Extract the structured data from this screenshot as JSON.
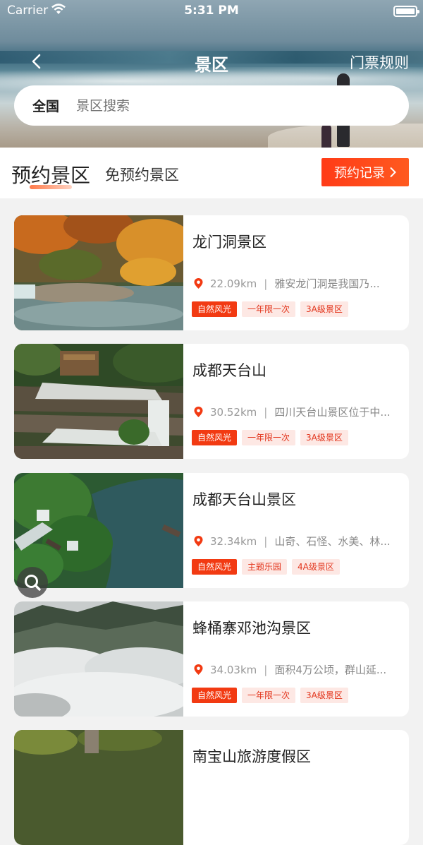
{
  "status": {
    "carrier": "Carrier",
    "time": "5:31 PM"
  },
  "nav": {
    "title": "景区",
    "rules": "门票规则"
  },
  "search": {
    "region": "全国",
    "placeholder": "景区搜索"
  },
  "tabs": {
    "active": "预约景区",
    "other": "免预约景区",
    "record": "预约记录"
  },
  "colors": {
    "accent": "#f23a12",
    "tag_light_bg": "#fde8e4",
    "tag_light_text": "#e2341b"
  },
  "items": [
    {
      "name": "龙门洞景区",
      "distance": "22.09km",
      "desc": "雅安龙门洞是我国乃...",
      "tags": [
        "自然风光",
        "一年限一次",
        "3A级景区"
      ]
    },
    {
      "name": "成都天台山",
      "distance": "30.52km",
      "desc": "四川天台山景区位于中...",
      "tags": [
        "自然风光",
        "一年限一次",
        "3A级景区"
      ]
    },
    {
      "name": "成都天台山景区",
      "distance": "32.34km",
      "desc": "山奇、石怪、水美、林...",
      "tags": [
        "自然风光",
        "主题乐园",
        "4A级景区"
      ]
    },
    {
      "name": "蜂桶寨邓池沟景区",
      "distance": "34.03km",
      "desc": "面积4万公顷，群山延...",
      "tags": [
        "自然风光",
        "一年限一次",
        "3A级景区"
      ]
    },
    {
      "name": "南宝山旅游度假区"
    }
  ]
}
